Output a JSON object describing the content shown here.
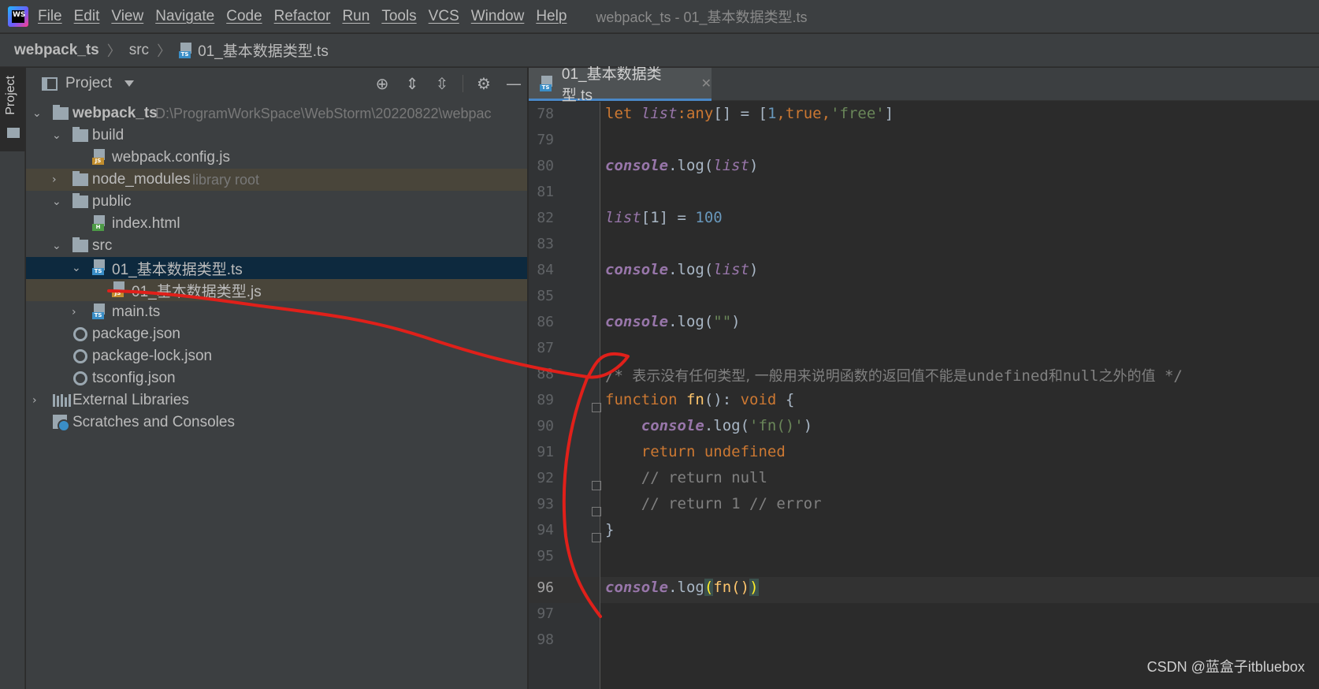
{
  "menu": {
    "app_icon_label": "WS",
    "items": [
      "File",
      "Edit",
      "View",
      "Navigate",
      "Code",
      "Refactor",
      "Run",
      "Tools",
      "VCS",
      "Window",
      "Help"
    ],
    "window_title": "webpack_ts - 01_基本数据类型.ts"
  },
  "breadcrumb": {
    "project": "webpack_ts",
    "folder": "src",
    "file": "01_基本数据类型.ts",
    "file_tag": "TS"
  },
  "toolstrip": {
    "project_tab": "Project"
  },
  "project_panel": {
    "title": "Project",
    "tree": {
      "root": {
        "name": "webpack_ts",
        "path": "D:\\ProgramWorkSpace\\WebStorm\\20220822\\webpac"
      },
      "build": "build",
      "webpack_config": "webpack.config.js",
      "node_modules": "node_modules",
      "node_modules_hint": "library root",
      "public": "public",
      "index_html": "index.html",
      "src": "src",
      "file_ts": "01_基本数据类型.ts",
      "file_js": "01_基本数据类型.js",
      "main_ts": "main.ts",
      "package_json": "package.json",
      "package_lock": "package-lock.json",
      "tsconfig": "tsconfig.json",
      "external_libraries": "External Libraries",
      "scratches": "Scratches and Consoles"
    },
    "tags": {
      "ts": "TS",
      "js": "JS",
      "html": "H",
      "xjs": "JS"
    }
  },
  "editor": {
    "tab_label": "01_基本数据类型.ts",
    "current_line": 96,
    "line_numbers": [
      "78",
      "79",
      "80",
      "81",
      "82",
      "83",
      "84",
      "85",
      "86",
      "87",
      "88",
      "89",
      "90",
      "91",
      "92",
      "93",
      "94",
      "95",
      "96",
      "97",
      "98"
    ],
    "code": {
      "l78_kw": "let ",
      "l78_var": "list",
      "l78_colon": ":",
      "l78_type": "any",
      "l78_rest1": "[] = [",
      "l78_n1": "1",
      "l78_c1": ",",
      "l78_true": "true",
      "l78_c2": ",",
      "l78_str": "'free'",
      "l78_end": "]",
      "l80_obj": "console",
      "l80_dot": ".log(",
      "l80_var": "list",
      "l80_end": ")",
      "l82_var": "list",
      "l82_mid": "[1] = ",
      "l82_num": "100",
      "l84_obj": "console",
      "l84_dot": ".log(",
      "l84_var": "list",
      "l84_end": ")",
      "l86_obj": "console",
      "l86_dot": ".log(",
      "l86_str": "\"\"",
      "l86_end": ")",
      "l88_a": "/* ",
      "l88_cjk1": "表示没有任何类型, 一般用来说明函数的返回值不能是",
      "l88_b": "undefined",
      "l88_cjk2": "和",
      "l88_c": "null",
      "l88_cjk3": "之外的值",
      "l88_d": " */",
      "l89_kw": "function ",
      "l89_fn": "fn",
      "l89_mid": "(): ",
      "l89_void": "void",
      "l89_end": " {",
      "l90_indent": "    ",
      "l90_obj": "console",
      "l90_dot": ".log(",
      "l90_str": "'fn()'",
      "l90_end": ")",
      "l91_indent": "    ",
      "l91_kw": "return undefined",
      "l92": "    // return null",
      "l93": "    // return 1 // error",
      "l94": "}",
      "l96_obj": "console",
      "l96_dot": ".log",
      "l96_p1": "(",
      "l96_fn": "fn()",
      "l96_p2": ")"
    }
  },
  "watermark": "CSDN @蓝盒子itbluebox",
  "colors": {
    "keyword": "#cc7832",
    "number": "#6897bb",
    "string": "#6a8759",
    "variable": "#9876aa",
    "function": "#ffc66d",
    "comment": "#808080",
    "selection": "#0d293e",
    "annotation_stroke": "#e0201a"
  }
}
